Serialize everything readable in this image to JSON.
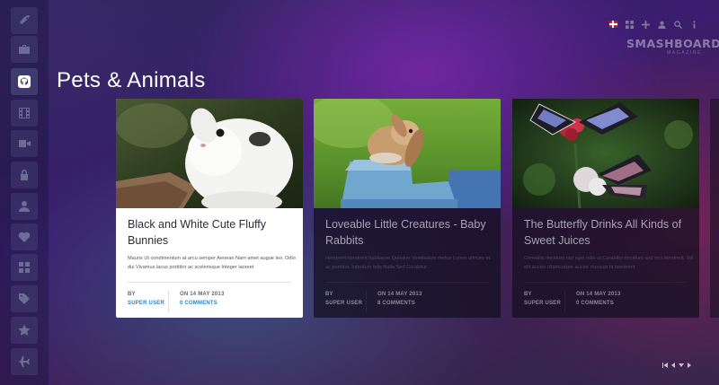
{
  "header": {
    "brand": "SMASHBOARD",
    "brand_sub": "MAGAZINE",
    "top_icons": [
      "uk-flag-icon",
      "grid-icon",
      "plus-icon",
      "user-icon",
      "search-icon",
      "info-icon"
    ]
  },
  "sidebar": {
    "items": [
      {
        "name": "rocket-icon",
        "active": false
      },
      {
        "name": "briefcase-icon",
        "active": false
      },
      {
        "name": "github-icon",
        "active": true
      },
      {
        "name": "film-icon",
        "active": false
      },
      {
        "name": "video-camera-icon",
        "active": false
      },
      {
        "name": "lock-icon",
        "active": false
      },
      {
        "name": "user-icon",
        "active": false
      },
      {
        "name": "heart-icon",
        "active": false
      },
      {
        "name": "dashboard-icon",
        "active": false
      },
      {
        "name": "tags-icon",
        "active": false
      },
      {
        "name": "star-icon",
        "active": false
      },
      {
        "name": "plane-icon",
        "active": false
      }
    ]
  },
  "page": {
    "title": "Pets & Animals"
  },
  "cards": [
    {
      "title": "Black and White Cute Fluffy Bunnies",
      "excerpt": "Mauris Ut condimentum at arcu semper Aenean Nam amet augue leo. Odio dui Vivamus lacus porttitor ac scelerisque Integer laoreet",
      "by_label": "BY",
      "author": "SUPER USER",
      "date": "ON 14 MAY 2013",
      "comments": "0 COMMENTS"
    },
    {
      "title": "Loveable Little Creatures - Baby Rabbits",
      "excerpt": "Hendrerit hendrerit habitasse Quisque Vestibulum metus Lorem ultrices et ac porttitor. Interdum felis Nulla Sed Curabitur",
      "by_label": "BY",
      "author": "SUPER USER",
      "date": "ON 14 MAY 2013",
      "comments": "8 COMMENTS"
    },
    {
      "title": "The Butterfly Drinks All Kinds of Sweet Juices",
      "excerpt": "Convallis tincidunt nisl eget odio ut Curabitur tincidunt sed orci hendrerit. Vel elit auctor ullamcorper auctor rhoncus id hendrerit",
      "by_label": "BY",
      "author": "SUPER USER",
      "date": "ON 14 MAY 2013",
      "comments": "0 COMMENTS"
    }
  ],
  "pager": {
    "icons": [
      "first-page-icon",
      "prev-page-icon",
      "next-page-icon",
      "last-page-icon"
    ]
  }
}
